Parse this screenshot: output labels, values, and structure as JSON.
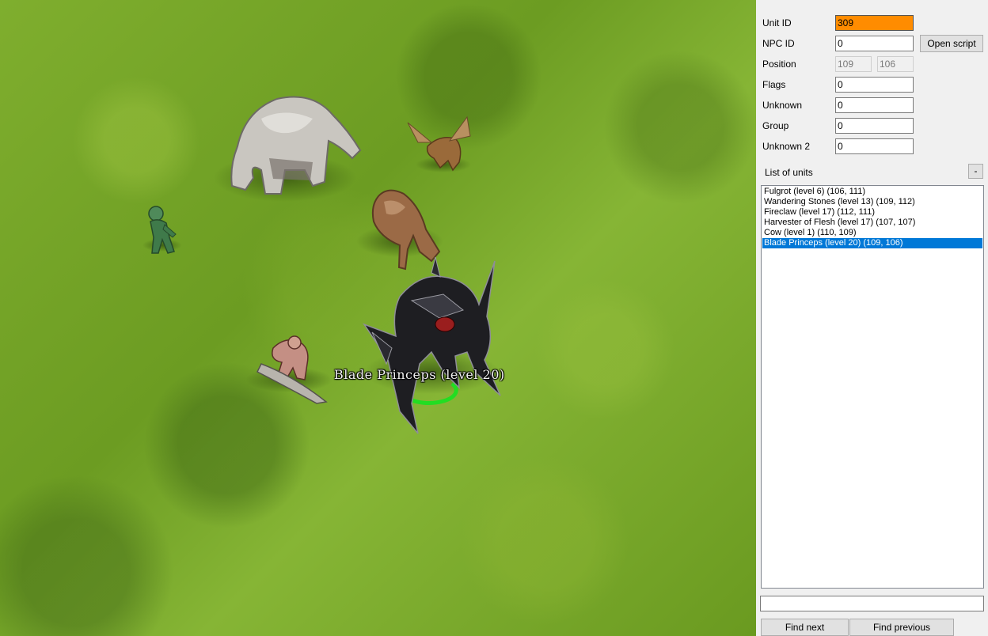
{
  "viewport": {
    "selected_unit_label": "Blade Princeps (level 20)"
  },
  "form": {
    "unit_id_label": "Unit ID",
    "unit_id_value": "309",
    "npc_id_label": "NPC ID",
    "npc_id_value": "0",
    "open_script_label": "Open script",
    "position_label": "Position",
    "position_x": "109",
    "position_y": "106",
    "flags_label": "Flags",
    "flags_value": "0",
    "unknown_label": "Unknown",
    "unknown_value": "0",
    "group_label": "Group",
    "group_value": "0",
    "unknown2_label": "Unknown 2",
    "unknown2_value": "0"
  },
  "units": {
    "header": "List of units",
    "collapse_label": "-",
    "items": [
      "Fulgrot (level 6) (106, 111)",
      "Wandering Stones (level 13) (109, 112)",
      "Fireclaw (level 17) (112, 111)",
      "Harvester of Flesh (level 17) (107, 107)",
      "Cow (level 1) (110, 109)",
      "Blade Princeps (level 20) (109, 106)"
    ],
    "selected_index": 5
  },
  "search": {
    "value": "",
    "find_next_label": "Find next",
    "find_previous_label": "Find previous"
  },
  "colors": {
    "highlight_field": "#ff8c00",
    "selection": "#0078d7",
    "selection_ring": "#22dd22"
  }
}
